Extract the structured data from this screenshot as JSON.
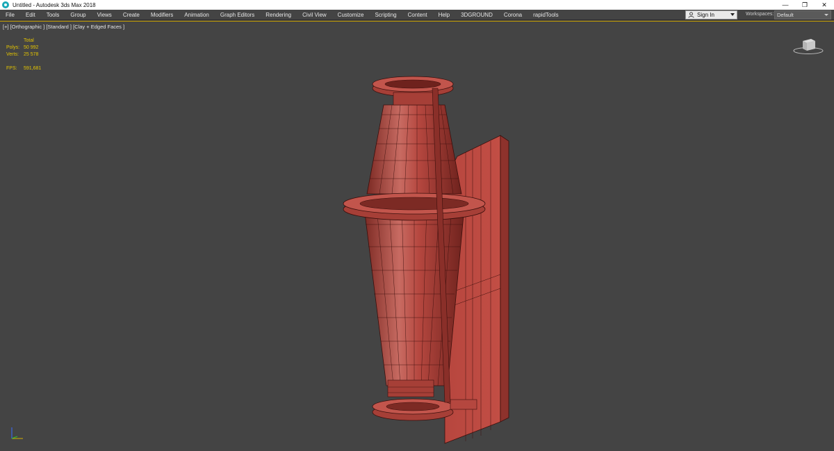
{
  "window": {
    "title": "Untitled - Autodesk 3ds Max 2018",
    "controls": {
      "minimize": "—",
      "restore": "❐",
      "close": "✕"
    }
  },
  "menubar": {
    "items": [
      "File",
      "Edit",
      "Tools",
      "Group",
      "Views",
      "Create",
      "Modifiers",
      "Animation",
      "Graph Editors",
      "Rendering",
      "Civil View",
      "Customize",
      "Scripting",
      "Content",
      "Help",
      "3DGROUND",
      "Corona",
      "rapidTools"
    ],
    "signin_label": "Sign In",
    "workspaces_label": "Workspaces:",
    "workspaces_value": "Default"
  },
  "viewport": {
    "label": "[+] [Orthographic ] [Standard ] [Clay + Edged Faces ]",
    "stats": {
      "total_label": "Total",
      "polys_label": "Polys:",
      "polys_value": "50 992",
      "verts_label": "Verts:",
      "verts_value": "25 578",
      "fps_label": "FPS:",
      "fps_value": "591,681"
    }
  },
  "colors": {
    "viewport_bg": "#444444",
    "clay": "#b5473f",
    "stats_text": "#e4c400",
    "active_border": "#c8a000"
  }
}
